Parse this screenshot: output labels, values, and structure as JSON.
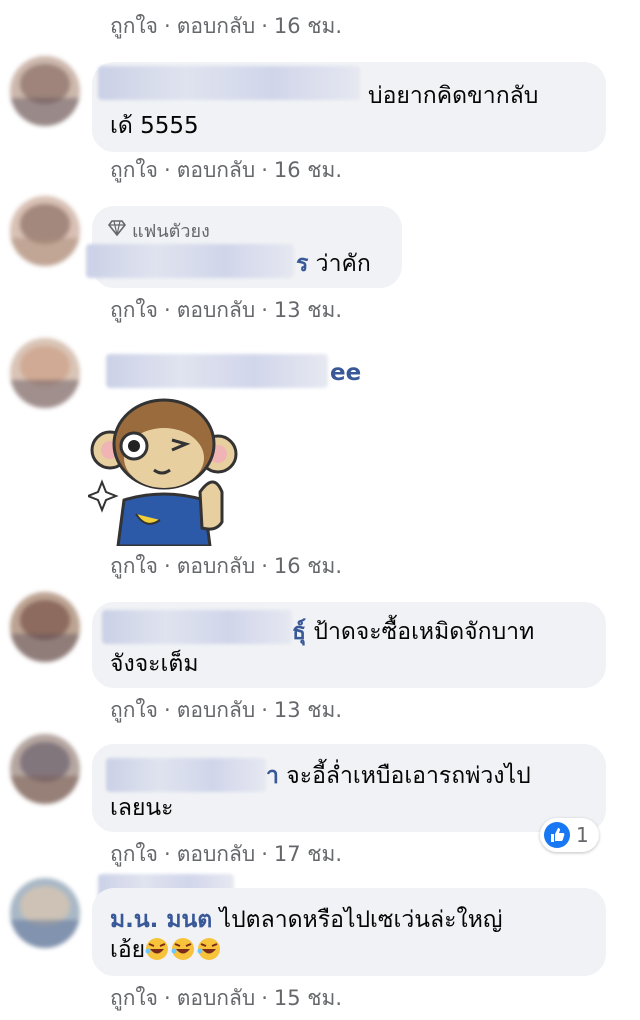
{
  "actions": {
    "like": "ถูกใจ",
    "reply": "ตอบกลับ",
    "dot": "·"
  },
  "comments": [
    {
      "time": "16 ชม."
    },
    {
      "text_line1": "บ่อยากคิดขากลับ",
      "text_line2": "เด้ 5555",
      "time": "16 ชม."
    },
    {
      "badge": "แฟนตัวยง",
      "name_tail": "ร",
      "text": "ว่าคัก",
      "time": "13 ชม."
    },
    {
      "name_tail": "ee",
      "sticker": "monkey-thumbs-up-sticker",
      "time": "16 ชม."
    },
    {
      "name_tail": "ธุ์",
      "text_line1": "ป้าดจะซื้อเหมิดจักบาท",
      "text_line2": "จังจะเต็ม",
      "time": "13 ชม."
    },
    {
      "name_tail": "า",
      "text_line1": "จะอี้ล่ำเหบือเอารถพ่วงไป",
      "text_line2": "เลยนะ",
      "time": "17 ชม.",
      "reaction_count": "1"
    },
    {
      "name": "ม.น. มนต",
      "text_line1": "ไปตลาดหรือไปเซเว่นล่ะใหญ่",
      "text_line2": "เอ้ย",
      "time": "15 ชม."
    }
  ],
  "colors": {
    "bubble": "#f0f2f5",
    "meta": "#65676b",
    "name": "#385898",
    "like": "#1877f2"
  }
}
